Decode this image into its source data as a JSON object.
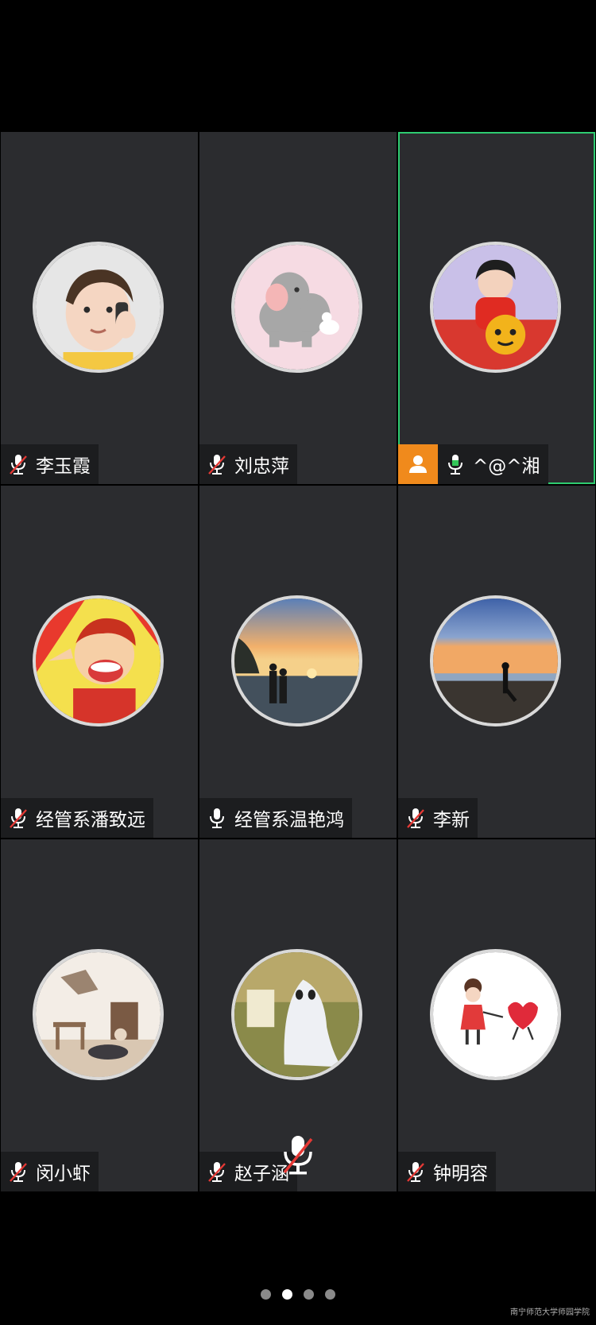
{
  "participants": [
    {
      "name": "李玉霞",
      "mic": "muted",
      "avatar": "toddler-phone",
      "active": false,
      "host": false
    },
    {
      "name": "刘忠萍",
      "mic": "muted",
      "avatar": "elephant-cartoon",
      "active": false,
      "host": false
    },
    {
      "name": "^@^湘",
      "mic": "speaking",
      "avatar": "girl-tiger-toy",
      "active": true,
      "host": true
    },
    {
      "name": "经管系潘致远",
      "mic": "muted",
      "avatar": "cartoon-basketball-boy",
      "active": false,
      "host": false
    },
    {
      "name": "经管系温艳鸿",
      "mic": "on",
      "avatar": "sunset-couple",
      "active": false,
      "host": false
    },
    {
      "name": "李新",
      "mic": "muted",
      "avatar": "beach-dusk",
      "active": false,
      "host": false
    },
    {
      "name": "闵小虾",
      "mic": "muted",
      "avatar": "cozy-room",
      "active": false,
      "host": false
    },
    {
      "name": "赵子涵",
      "mic": "muted",
      "avatar": "ghost-costume",
      "active": false,
      "host": false
    },
    {
      "name": "钟明容",
      "mic": "muted",
      "avatar": "girl-with-heart",
      "active": false,
      "host": false
    }
  ],
  "pager": {
    "total": 4,
    "current": 2
  },
  "watermark": "南宁师范大学师园学院",
  "colors": {
    "tile_bg": "#2b2c2f",
    "active_border": "#2ecc71",
    "host_badge": "#f08a1c",
    "muted_slash": "#e53935",
    "speaking_green": "#34c759"
  }
}
